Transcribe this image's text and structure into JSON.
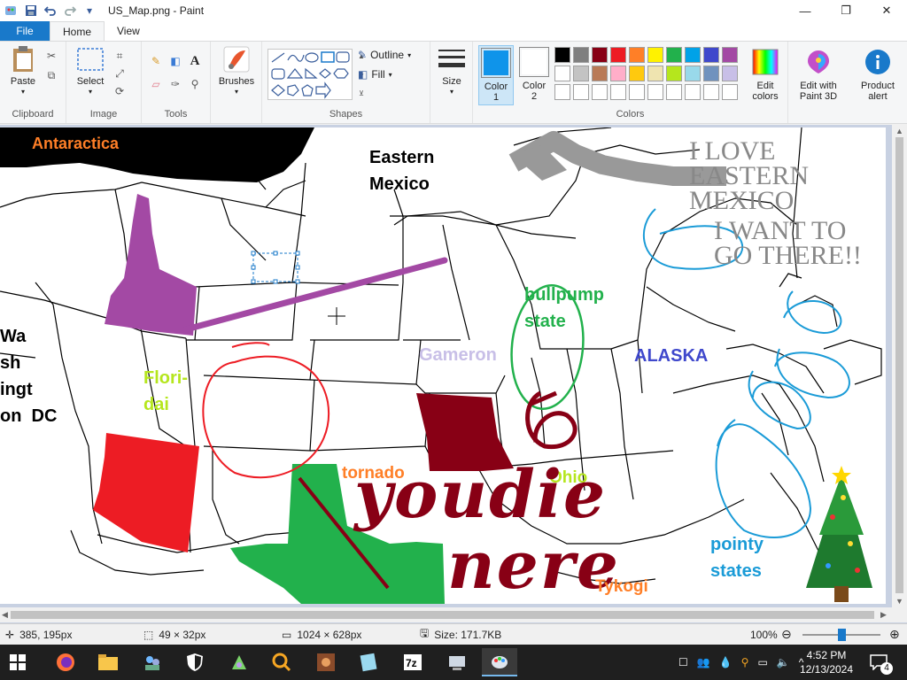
{
  "window": {
    "title": "US_Map.png - Paint",
    "minimize": "—",
    "maximize": "❐",
    "close": "✕"
  },
  "tabs": [
    {
      "label": "File"
    },
    {
      "label": "Home"
    },
    {
      "label": "View"
    }
  ],
  "ribbon": {
    "clipboard": {
      "label": "Clipboard",
      "paste": "Paste"
    },
    "image": {
      "label": "Image",
      "select": "Select"
    },
    "tools": {
      "label": "Tools"
    },
    "brushes": {
      "label": "Brushes"
    },
    "shapes": {
      "label": "Shapes",
      "outline": "Outline",
      "fill": "Fill"
    },
    "size": {
      "label": "Size"
    },
    "colors": {
      "label": "Colors",
      "color1": "Color\n1",
      "color1_l1": "Color",
      "color1_l2": "1",
      "color2_l1": "Color",
      "color2_l2": "2",
      "edit_l1": "Edit",
      "edit_l2": "colors",
      "color1_value": "#0f94ea",
      "color2_value": "#ffffff",
      "palette_row1": [
        "#000000",
        "#7f7f7f",
        "#880015",
        "#ed1c24",
        "#ff7f27",
        "#fff200",
        "#22b14c",
        "#00a2e8",
        "#3f48cc",
        "#a349a4"
      ],
      "palette_row2": [
        "#ffffff",
        "#c3c3c3",
        "#b97a57",
        "#ffaec9",
        "#ffc90e",
        "#efe4b0",
        "#b5e61d",
        "#99d9ea",
        "#7092be",
        "#c8bfe7"
      ],
      "palette_row3": [
        "#ffffff",
        "#ffffff",
        "#ffffff",
        "#ffffff",
        "#ffffff",
        "#ffffff",
        "#ffffff",
        "#ffffff",
        "#ffffff",
        "#ffffff"
      ]
    },
    "paint3d_l1": "Edit with",
    "paint3d_l2": "Paint 3D",
    "alert_l1": "Product",
    "alert_l2": "alert"
  },
  "canvas": {
    "labels": {
      "antaractica": "Antaractica",
      "eastern": "Eastern",
      "mexico": "Mexico",
      "love1": "I LOVE",
      "love2": "EASTERN",
      "love3": "MEXICO",
      "want1": "I WANT TO",
      "want2": "GO THERE!!",
      "wa1": "Wa",
      "wa2": "sh",
      "wa3": "ingt",
      "wa4": "on  DC",
      "flori1": "Flori-",
      "flori2": "dai",
      "gameron": "Gameron",
      "alaska": "ALASKA",
      "bullpump1": "bullpump",
      "bullpump2": "state",
      "tornado": "tornado",
      "ohio": "Ohio",
      "youdie1": "youdie",
      "youdie2": "nere",
      "pointy1": "pointy",
      "pointy2": "states",
      "tykogi": "Tykogi"
    }
  },
  "status": {
    "cursor": "385, 195px",
    "selection": "49 × 32px",
    "canvas_size": "1024 × 628px",
    "file_size": "Size: 171.7KB",
    "zoom": "100%"
  },
  "taskbar": {
    "time": "4:52 PM",
    "date": "12/13/2024",
    "notifications": "4"
  }
}
